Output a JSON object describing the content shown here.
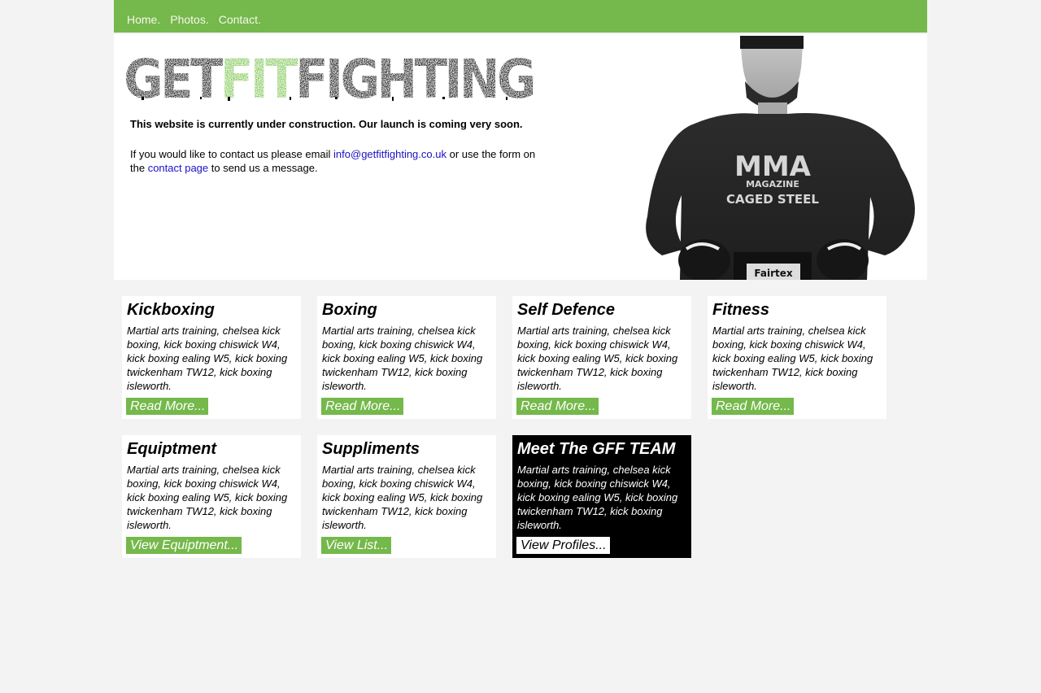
{
  "nav": {
    "items": [
      "Home.",
      "Photos.",
      "Contact."
    ]
  },
  "logo": {
    "parts": [
      "GET",
      "FIT",
      "FIGHTING"
    ]
  },
  "intro": {
    "headline": "This website is currently under construction. Our launch is coming very soon.",
    "contact_before": "If you would like to contact us please email ",
    "email": "info@getfitfighting.co.uk",
    "contact_middle": " or use the form on the ",
    "contact_link": "contact page",
    "contact_after": " to send us a message."
  },
  "photo": {
    "shirt_text_1": "MMA",
    "shirt_text_2": "MAGAZINE",
    "shirt_text_3": "CAGED STEEL",
    "belt_text": "Fairtex"
  },
  "cards": [
    {
      "title": "Kickboxing",
      "text": "Martial arts training, chelsea kick boxing, kick boxing chiswick W4, kick boxing ealing W5, kick boxing twickenham TW12, kick boxing isleworth.",
      "button": "Read More..."
    },
    {
      "title": "Boxing",
      "text": "Martial arts training, chelsea kick boxing, kick boxing chiswick W4, kick boxing ealing W5, kick boxing twickenham TW12, kick boxing isleworth.",
      "button": "Read More..."
    },
    {
      "title": "Self Defence",
      "text": "Martial arts training, chelsea kick boxing, kick boxing chiswick W4, kick boxing ealing W5, kick boxing twickenham TW12, kick boxing isleworth.",
      "button": "Read More..."
    },
    {
      "title": "Fitness",
      "text": "Martial arts training, chelsea kick boxing, kick boxing chiswick W4, kick boxing ealing W5, kick boxing twickenham TW12, kick boxing isleworth.",
      "button": "Read More..."
    },
    {
      "title": "Equiptment",
      "text": "Martial arts training, chelsea kick boxing, kick boxing chiswick W4, kick boxing ealing W5, kick boxing twickenham TW12, kick boxing isleworth.",
      "button": "View Equiptment..."
    },
    {
      "title": "Suppliments",
      "text": "Martial arts training, chelsea kick boxing, kick boxing chiswick W4, kick boxing ealing W5, kick boxing twickenham TW12, kick boxing isleworth.",
      "button": "View List..."
    },
    {
      "title": "Meet The GFF TEAM",
      "text": "Martial arts training, chelsea kick boxing, kick boxing chiswick W4, kick boxing ealing W5, kick boxing twickenham TW12, kick boxing isleworth.",
      "button": "View Profiles..."
    }
  ],
  "colors": {
    "brand_green": "#75b84b",
    "page_background": "#f3f3f3",
    "link_blue": "#1a12c4",
    "team_card": "#000000"
  }
}
